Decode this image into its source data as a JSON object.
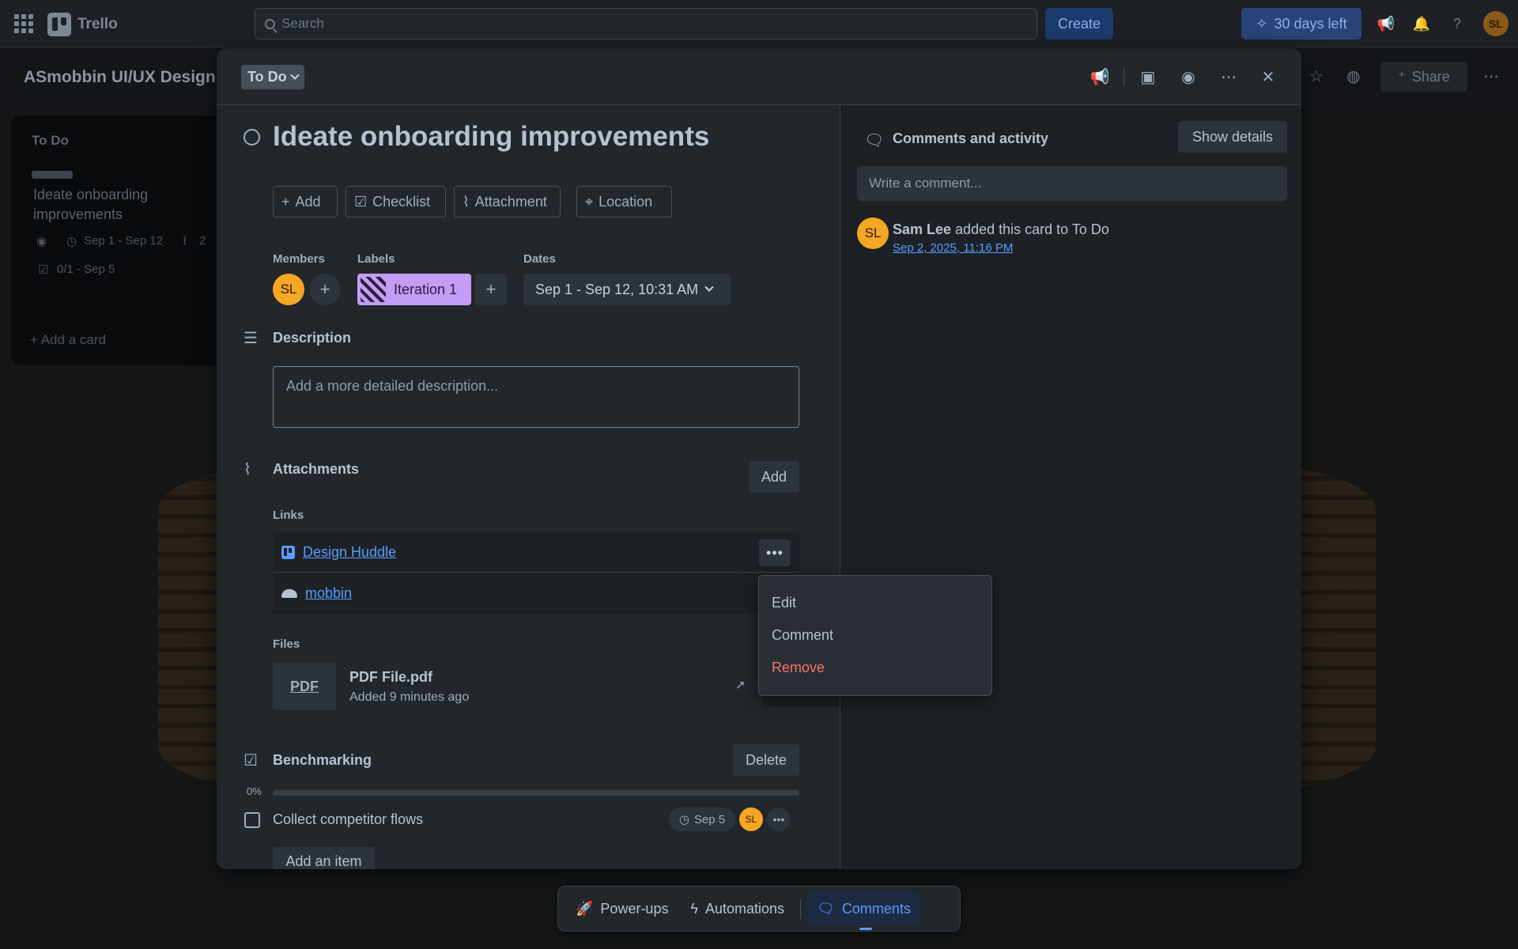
{
  "topnav": {
    "app_name": "Trello",
    "search_placeholder": "Search",
    "create_label": "Create",
    "trial_label": "30 days left",
    "user_initials": "SL"
  },
  "board": {
    "title": "ASmobbin UI/UX Design",
    "share_label": "Share",
    "list_title": "To Do",
    "card_title": "Ideate onboarding improvements",
    "card_dates": "Sep 1 - Sep 12",
    "card_attachments": "2",
    "card_checklist": "0/1 - Sep 5",
    "add_card_label": "Add a card"
  },
  "modal": {
    "status": "To Do",
    "title": "Ideate onboarding improvements",
    "actions": [
      "Add",
      "Checklist",
      "Attachment",
      "Location"
    ],
    "members_label": "Members",
    "member_initials": "SL",
    "labels_label": "Labels",
    "label_name": "Iteration 1",
    "dates_label": "Dates",
    "dates_value": "Sep 1 - Sep 12, 10:31 AM",
    "description": {
      "title": "Description",
      "placeholder": "Add a more detailed description..."
    },
    "attachments": {
      "title": "Attachments",
      "add_label": "Add",
      "links_label": "Links",
      "links": [
        "Design Huddle",
        "mobbin"
      ],
      "files_label": "Files",
      "file": {
        "thumb": "PDF",
        "name": "PDF File.pdf",
        "added": "Added 9 minutes ago"
      }
    },
    "checklist": {
      "title": "Benchmarking",
      "delete_label": "Delete",
      "progress_text": "0%",
      "progress": 0,
      "items": [
        {
          "text": "Collect competitor flows",
          "due": "Sep 5",
          "assignee": "SL"
        }
      ],
      "add_item_label": "Add an item"
    }
  },
  "activity": {
    "title": "Comments and activity",
    "show_details_label": "Show details",
    "comment_placeholder": "Write a comment...",
    "entry": {
      "initials": "SL",
      "user": "Sam Lee",
      "action": " added this card to To Do",
      "time": "Sep 2, 2025, 11:16 PM"
    }
  },
  "context_menu": {
    "items": [
      "Edit",
      "Comment",
      "Remove"
    ]
  },
  "dock": {
    "items": [
      "Power-ups",
      "Automations",
      "Comments"
    ],
    "active": "Comments"
  },
  "colors": {
    "label_purple": "#c49cf4",
    "avatar_orange": "#f5a623",
    "link_blue": "#579dff",
    "danger": "#f87462"
  }
}
